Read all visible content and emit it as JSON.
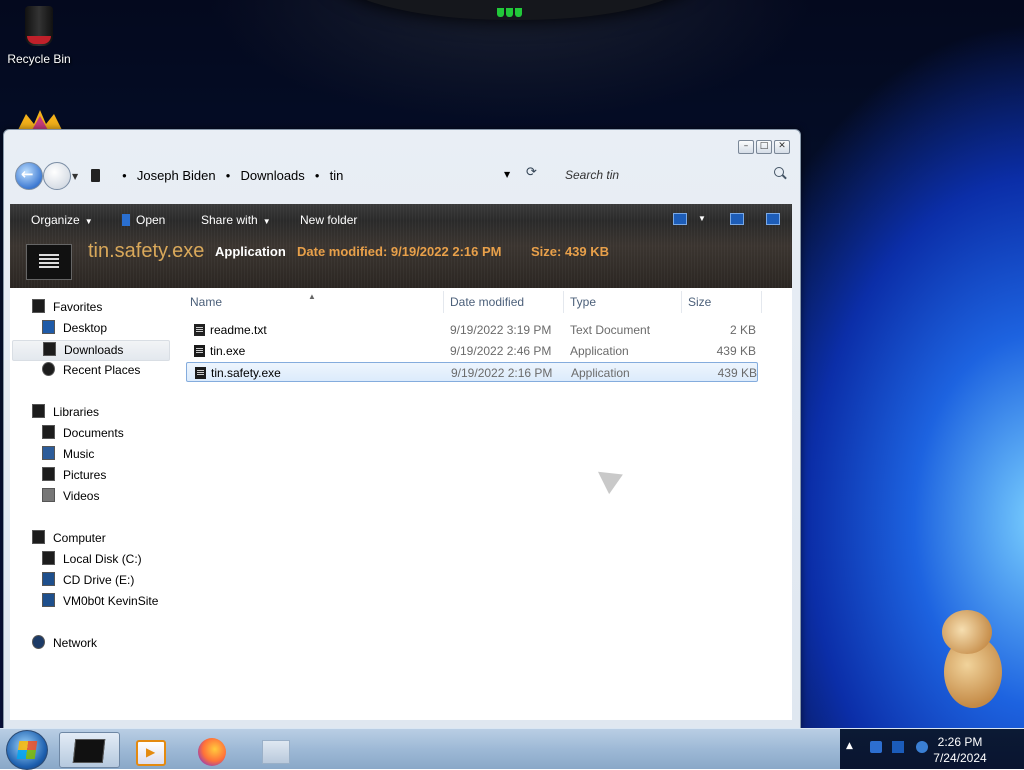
{
  "desktop": {
    "recycle_bin_label": "Recycle Bin"
  },
  "window": {
    "address": {
      "crumbs": [
        "Joseph Biden",
        "Downloads",
        "tin"
      ]
    },
    "search_placeholder": "Search tin",
    "toolbar": {
      "organize": "Organize",
      "open": "Open",
      "share_with": "Share with",
      "new_folder": "New folder"
    },
    "details": {
      "name": "tin.safety.exe",
      "type": "Application",
      "date_modified": "Date modified: 9/19/2022 2:16 PM",
      "size": "Size: 439 KB"
    },
    "nav": {
      "favorites": "Favorites",
      "desktop": "Desktop",
      "downloads": "Downloads",
      "recent": "Recent Places",
      "libraries": "Libraries",
      "documents": "Documents",
      "music": "Music",
      "pictures": "Pictures",
      "videos": "Videos",
      "computer": "Computer",
      "local_disk": "Local Disk (C:)",
      "cd_drive": "CD Drive (E:)",
      "vm_site": "VM0b0t KevinSite",
      "network": "Network"
    },
    "columns": {
      "name": "Name",
      "date": "Date modified",
      "type": "Type",
      "size": "Size"
    },
    "files": [
      {
        "name": "readme.txt",
        "date": "9/19/2022 3:19 PM",
        "type": "Text Document",
        "size": "2 KB"
      },
      {
        "name": "tin.exe",
        "date": "9/19/2022 2:46 PM",
        "type": "Application",
        "size": "439 KB"
      },
      {
        "name": "tin.safety.exe",
        "date": "9/19/2022 2:16 PM",
        "type": "Application",
        "size": "439 KB"
      }
    ]
  },
  "taskbar": {
    "time": "2:26 PM",
    "date": "7/24/2024"
  },
  "colors": {
    "details_name": "#d9a85a",
    "details_value": "#e8a04a",
    "selection_border": "#84acdd"
  }
}
